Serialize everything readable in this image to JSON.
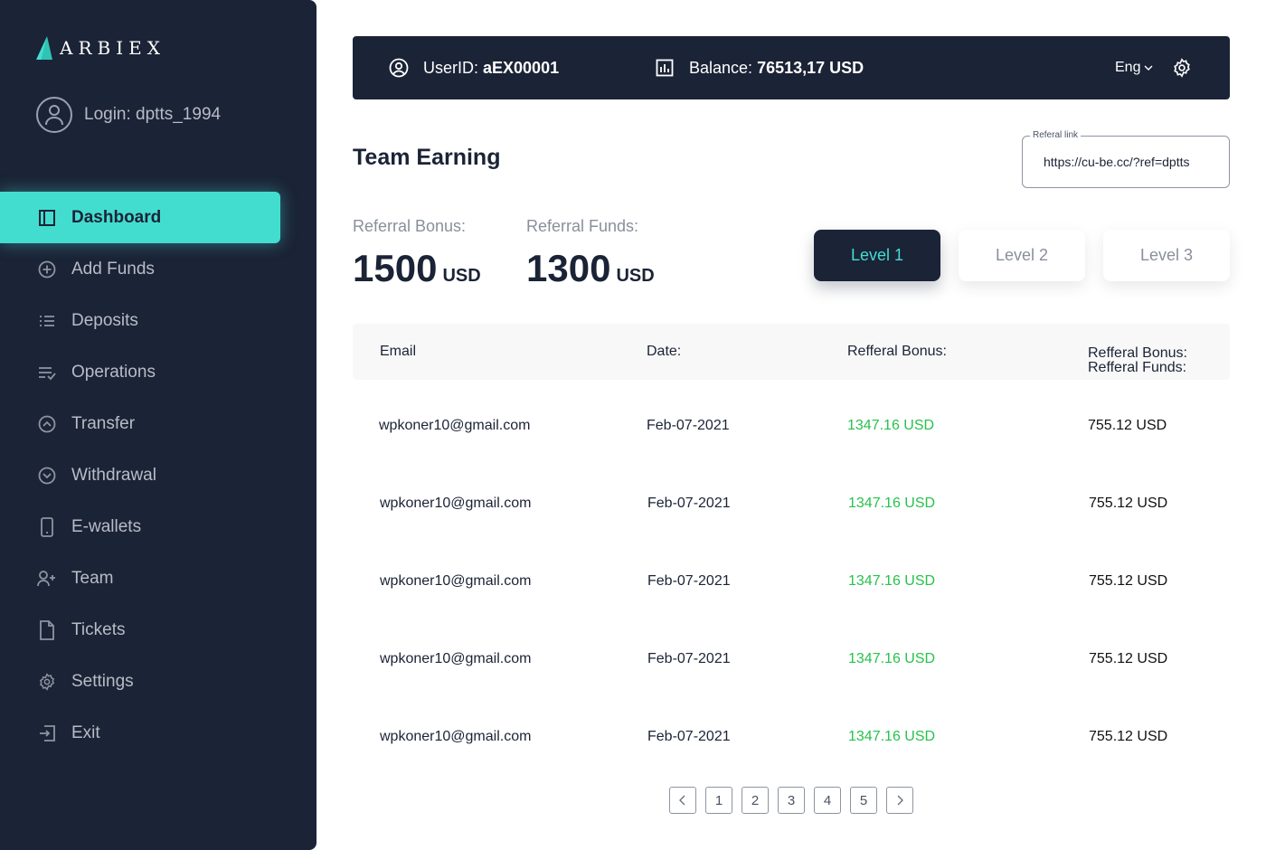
{
  "app": {
    "logo_text": "ARBIEX"
  },
  "sidebar": {
    "login_text": "Login: dptts_1994",
    "items": [
      {
        "label": "Dashboard",
        "icon": "dashboard-icon",
        "active": true
      },
      {
        "label": "Add Funds",
        "icon": "plus-circle-icon"
      },
      {
        "label": "Deposits",
        "icon": "list-icon"
      },
      {
        "label": "Operations",
        "icon": "list-check-icon"
      },
      {
        "label": "Transfer",
        "icon": "chevron-up-circle-icon"
      },
      {
        "label": "Withdrawal",
        "icon": "chevron-down-circle-icon"
      },
      {
        "label": "E-wallets",
        "icon": "phone-icon"
      },
      {
        "label": "Team",
        "icon": "add-user-icon"
      },
      {
        "label": "Tickets",
        "icon": "document-icon"
      },
      {
        "label": "Settings",
        "icon": "gear-icon"
      },
      {
        "label": "Exit",
        "icon": "exit-icon"
      }
    ]
  },
  "topbar": {
    "user_label": "UserID:",
    "user_value": "aEX00001",
    "balance_label": "Balance:",
    "balance_value": "76513,17 USD",
    "language": "Eng"
  },
  "main": {
    "title": "Team Earning",
    "referral_link_label": "Referal link",
    "referral_link_value": "https://cu-be.cc/?ref=dptts",
    "referral_bonus_label": "Referral Bonus:",
    "referral_bonus_value": "1500",
    "referral_bonus_unit": "USD",
    "referral_funds_label": "Referral Funds:",
    "referral_funds_value": "1300",
    "referral_funds_unit": "USD",
    "levels": [
      "Level 1",
      "Level 2",
      "Level 3"
    ],
    "active_level": 0
  },
  "table": {
    "headers": [
      "Email",
      "Date:",
      "Refferal Bonus:",
      "Refferal Bonus:\nRefferal Funds:"
    ],
    "rows": [
      [
        "wpkoner10@gmail.com",
        "Feb-07-2021",
        "1347.16 USD",
        "755.12 USD"
      ],
      [
        "wpkoner10@gmail.com",
        "Feb-07-2021",
        "1347.16 USD",
        "755.12 USD"
      ],
      [
        "wpkoner10@gmail.com",
        "Feb-07-2021",
        "1347.16 USD",
        "755.12 USD"
      ],
      [
        "wpkoner10@gmail.com",
        "Feb-07-2021",
        "1347.16 USD",
        "755.12 USD"
      ],
      [
        "wpkoner10@gmail.com",
        "Feb-07-2021",
        "1347.16 USD",
        "755.12 USD"
      ]
    ]
  },
  "pagination": {
    "pages": [
      "1",
      "2",
      "3",
      "4",
      "5"
    ]
  },
  "colors": {
    "navy": "#1b2336",
    "accent": "#43ddd0",
    "positive": "#27c24c"
  }
}
